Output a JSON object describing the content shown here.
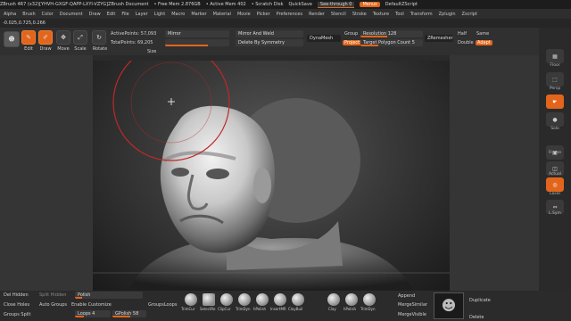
{
  "title_bar": {
    "app": "ZBrush 4R7 (x32)[YHVH-GXGF-QAPP-LXYI-VZYG]ZBrush Document",
    "free_mem": "• Free Mem 2.876GB",
    "active_mem": "• Active Mem 402",
    "scratch": "• Scratch Disk",
    "quicksave": "QuickSave",
    "see_through": "See-through  0",
    "menus": "Menus",
    "script": "DefaultZScript"
  },
  "menu": [
    "Alpha",
    "Brush",
    "Color",
    "Document",
    "Draw",
    "Edit",
    "File",
    "Layer",
    "Light",
    "Macro",
    "Marker",
    "Material",
    "Movie",
    "Picker",
    "Preferences",
    "Render",
    "Stencil",
    "Stroke",
    "Texture",
    "Tool",
    "Transform",
    "Zplugin",
    "Zscript"
  ],
  "coords": "-0.025,0.725,0.266",
  "toolbar": {
    "edit": "Edit",
    "draw": "Draw",
    "move": "Move",
    "scale": "Scale",
    "rotate": "Rotate",
    "active_points": "ActivePoints: 57,093",
    "total_points": "TotalPoints: 69,205",
    "mirror": "Mirror",
    "size": "Size",
    "mirror_weld": "Mirror And Weld",
    "delete_sym": "Delete By Symmetry",
    "dynamesh": "DynaMesh",
    "group": "Group",
    "project": "Project",
    "resolution": "Resolution 128",
    "target_poly": "Target Polygon Count 5",
    "zremesher": "ZRemesher",
    "half": "Half",
    "same": "Same",
    "double": "Double",
    "adapt": "Adapt"
  },
  "right_tray": {
    "floor": "Floor",
    "persp": "Persp",
    "solo": "Solo",
    "frame": "Frame",
    "actual": "Actual",
    "local": "Local",
    "lsym": "L.Sym"
  },
  "bottom": {
    "del_hidden": "Del Hidden",
    "split_hidden": "Split Hidden",
    "polish": "Polish",
    "close_holes": "Close Holes",
    "auto_groups": "Auto Groups",
    "enable_customize": "Enable Customize",
    "groups_split": "Groups Split",
    "loops": "Loops 4",
    "gpolish": "GPolish 58",
    "grouploops": "GroupsLoops",
    "append": "Append",
    "merge_similar": "MergeSimilar",
    "merge_visible": "MergeVisible",
    "duplicate": "Duplicate",
    "delete": "Delete",
    "brushes": [
      "TrimCur",
      "SelectRe",
      "ClipCur",
      "TrimDyn",
      "hPolish",
      "InsertMR",
      "ClayBuil",
      "Clay",
      "hPolish",
      "TrimDyn"
    ]
  },
  "colors": {
    "accent": "#e2651b",
    "background": "#2a2a2a",
    "canvas": "#3a3a3a"
  }
}
